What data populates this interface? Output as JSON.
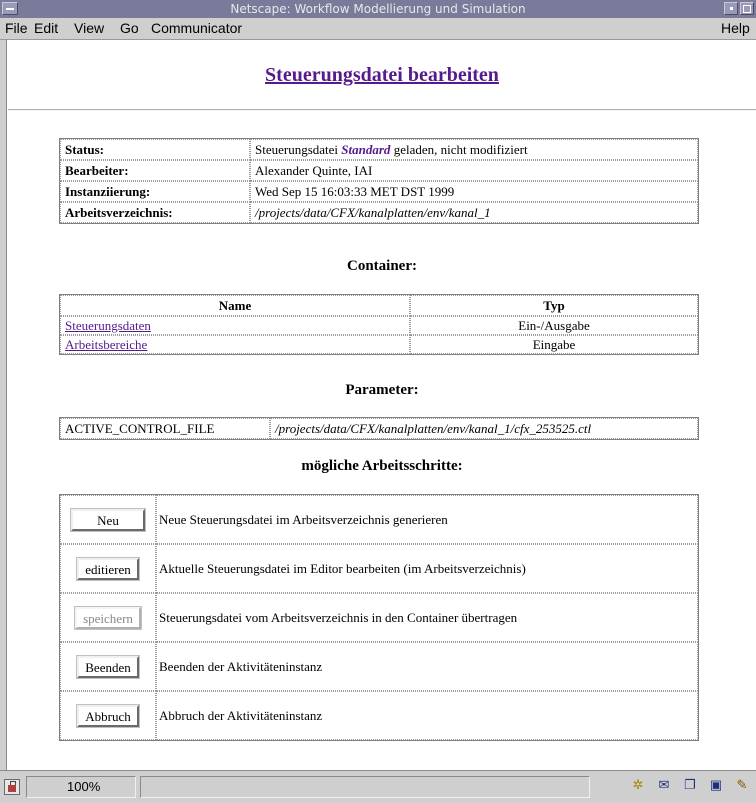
{
  "window": {
    "title": "Netscape: Workflow Modellierung und Simulation"
  },
  "menu": {
    "file": "File",
    "edit": "Edit",
    "view": "View",
    "go": "Go",
    "communicator": "Communicator",
    "help": "Help"
  },
  "page": {
    "title": "Steuerungsdatei bearbeiten"
  },
  "status": {
    "rows": {
      "status_label": "Status:",
      "status_prefix": "Steuerungsdatei ",
      "status_link": "Standard",
      "status_suffix": " geladen, nicht modifiziert",
      "bearbeiter_label": "Bearbeiter:",
      "bearbeiter_value": "Alexander Quinte, IAI",
      "instanz_label": "Instanziierung:",
      "instanz_value": "Wed Sep 15 16:03:33 MET DST 1999",
      "verz_label": "Arbeitsverzeichnis:",
      "verz_value": "/projects/data/CFX/kanalplatten/env/kanal_1"
    }
  },
  "container": {
    "heading": "Container:",
    "col_name": "Name",
    "col_typ": "Typ",
    "rows": [
      {
        "name": "Steuerungsdaten",
        "typ": "Ein-/Ausgabe"
      },
      {
        "name": "Arbeitsbereiche",
        "typ": "Eingabe"
      }
    ]
  },
  "parameter": {
    "heading": "Parameter:",
    "name": "ACTIVE_CONTROL_FILE",
    "value": "/projects/data/CFX/kanalplatten/env/kanal_1/cfx_253525.ctl"
  },
  "steps": {
    "heading": "mögliche Arbeitsschritte:",
    "items": [
      {
        "button": "Neu",
        "desc": "Neue Steuerungsdatei im Arbeitsverzeichnis generieren"
      },
      {
        "button": "editieren",
        "desc": "Aktuelle Steuerungsdatei im Editor bearbeiten (im Arbeitsverzeichnis)"
      },
      {
        "button": "speichern",
        "desc": "Steuerungsdatei vom Arbeitsverzeichnis in den Container übertragen"
      },
      {
        "button": "Beenden",
        "desc": "Beenden der Aktivitäteninstanz"
      },
      {
        "button": "Abbruch",
        "desc": "Abbruch der Aktivitäteninstanz"
      }
    ]
  },
  "statusbar": {
    "zoom": "100%"
  }
}
